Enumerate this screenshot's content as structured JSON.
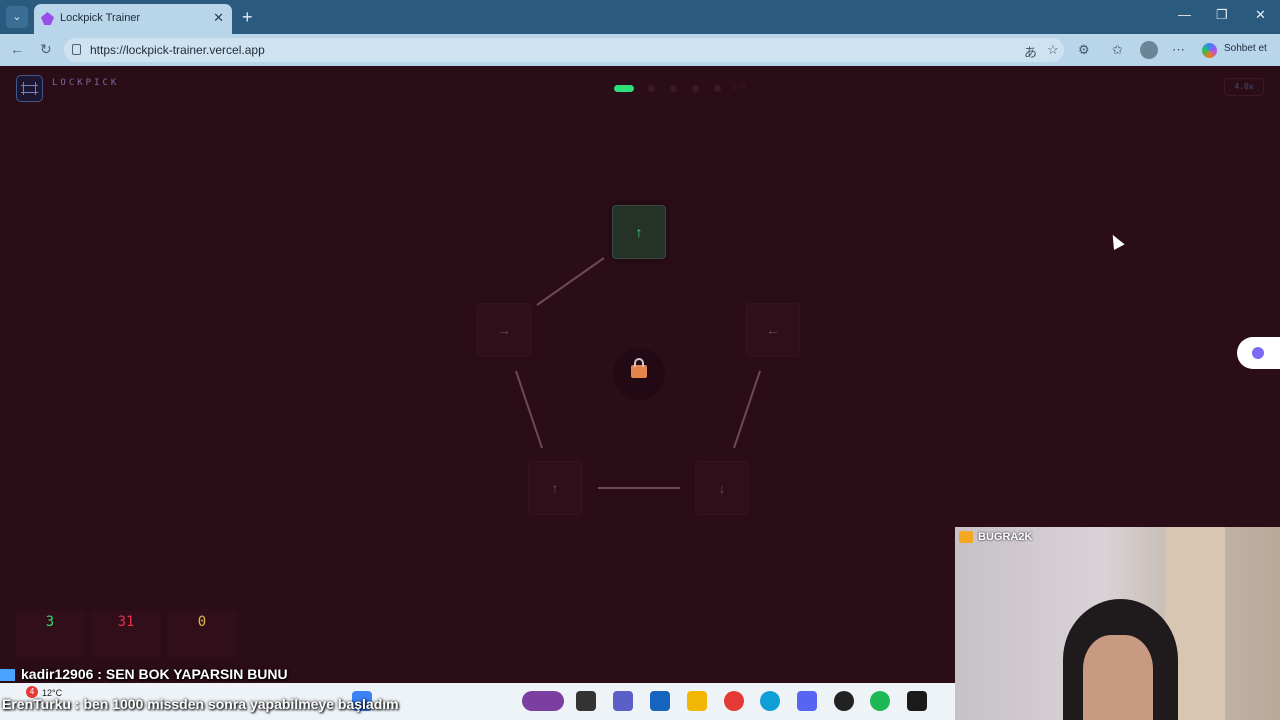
{
  "browser": {
    "tab_title": "Lockpick Trainer",
    "url": "https://lockpick-trainer.vercel.app",
    "copilot_label": "Sohbet et"
  },
  "app": {
    "logo_title": "LOCKPICK",
    "speed": "4.0x",
    "keys": [
      {
        "arrow": "↑",
        "state": "active"
      },
      {
        "arrow": "←",
        "state": "idle"
      },
      {
        "arrow": "↓",
        "state": "idle"
      },
      {
        "arrow": "↑",
        "state": "idle"
      },
      {
        "arrow": "→",
        "state": "idle"
      }
    ],
    "progress": {
      "current": 1,
      "total": 6
    },
    "stats": [
      {
        "value": "3",
        "color": "#36d86c"
      },
      {
        "value": "31",
        "color": "#e5304b"
      },
      {
        "value": "0",
        "color": "#e8b84a"
      }
    ]
  },
  "overlay": {
    "chat": [
      {
        "user": "kadir12906",
        "message": "SEN BOK YAPARSIN BUNU"
      },
      {
        "user": "ErenTurku",
        "message": "ben 1000 missden sonra yapabilmeye başladım"
      }
    ],
    "streamer": "BUGRA2K",
    "weather": "12°C",
    "notification_count": "4"
  },
  "colors": {
    "background": "#2b0d18",
    "accent_green": "#2fe07a",
    "lock": "#e5854a"
  }
}
